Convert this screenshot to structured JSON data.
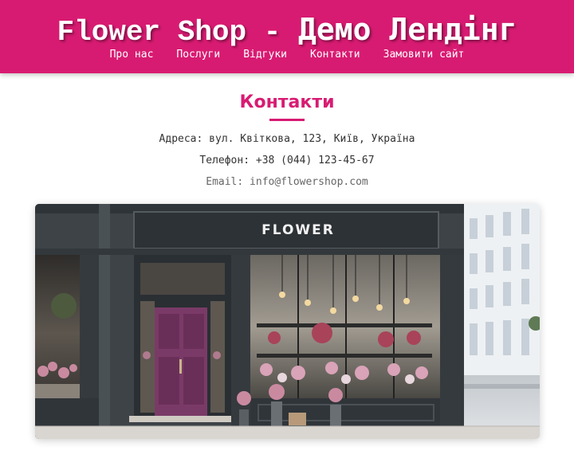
{
  "header": {
    "title_part1": "Flower Shop - ",
    "title_part2": "Демо Лендінг",
    "nav": [
      "Про нас",
      "Послуги",
      "Відгуки",
      "Контакти",
      "Замовити сайт"
    ]
  },
  "contacts": {
    "title": "Контакти",
    "address": "Адреса: вул. Квіткова, 123, Київ, Україна",
    "phone": "Телефон: +38 (044) 123-45-67",
    "email": "Email: info@flowershop.com"
  },
  "image": {
    "sign_text": "FLOWER"
  },
  "colors": {
    "brand": "#d81b72",
    "door": "#7a3a67",
    "facade": "#3d4347"
  }
}
